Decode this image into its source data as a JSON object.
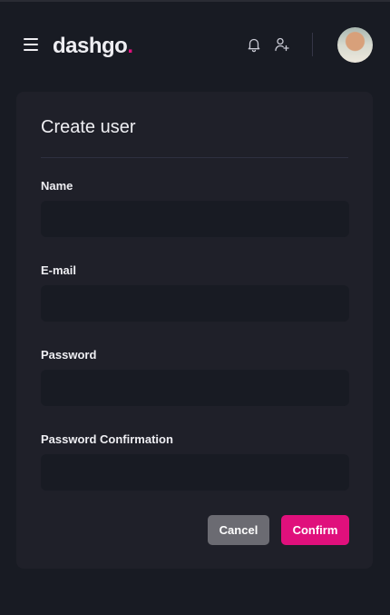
{
  "header": {
    "logo_text": "dashgo",
    "logo_dot": ".",
    "icons": [
      "menu-icon",
      "bell-icon",
      "user-add-icon"
    ]
  },
  "form": {
    "title": "Create user",
    "fields": [
      {
        "label": "Name",
        "value": "",
        "placeholder": ""
      },
      {
        "label": "E-mail",
        "value": "",
        "placeholder": ""
      },
      {
        "label": "Password",
        "value": "",
        "placeholder": ""
      },
      {
        "label": "Password Confirmation",
        "value": "",
        "placeholder": ""
      }
    ],
    "cancel_label": "Cancel",
    "confirm_label": "Confirm"
  },
  "colors": {
    "background": "#181b23",
    "card": "#1f2029",
    "accent": "#e0107c",
    "cancel_button": "#6b6b72"
  }
}
